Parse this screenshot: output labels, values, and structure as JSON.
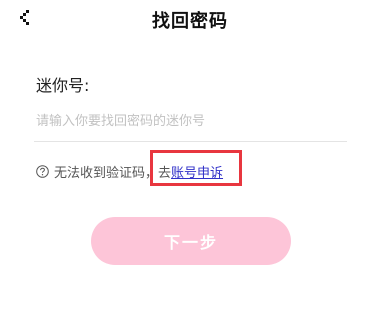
{
  "header": {
    "title": "找回密码",
    "back_icon": "chevron-left-icon"
  },
  "form": {
    "label": "迷你号:",
    "input_value": "",
    "input_placeholder": "请输入你要找回密码的迷你号"
  },
  "help": {
    "icon": "question-circle-icon",
    "text": "无法收到验证码，去",
    "link_label": "账号申诉"
  },
  "next_button": {
    "label": "下一步",
    "background_color": "#fdc5d8",
    "text_color": "#ffffff"
  },
  "colors": {
    "link": "#3030c8",
    "highlight_border": "#e8363f",
    "placeholder": "#c2c2c2"
  }
}
